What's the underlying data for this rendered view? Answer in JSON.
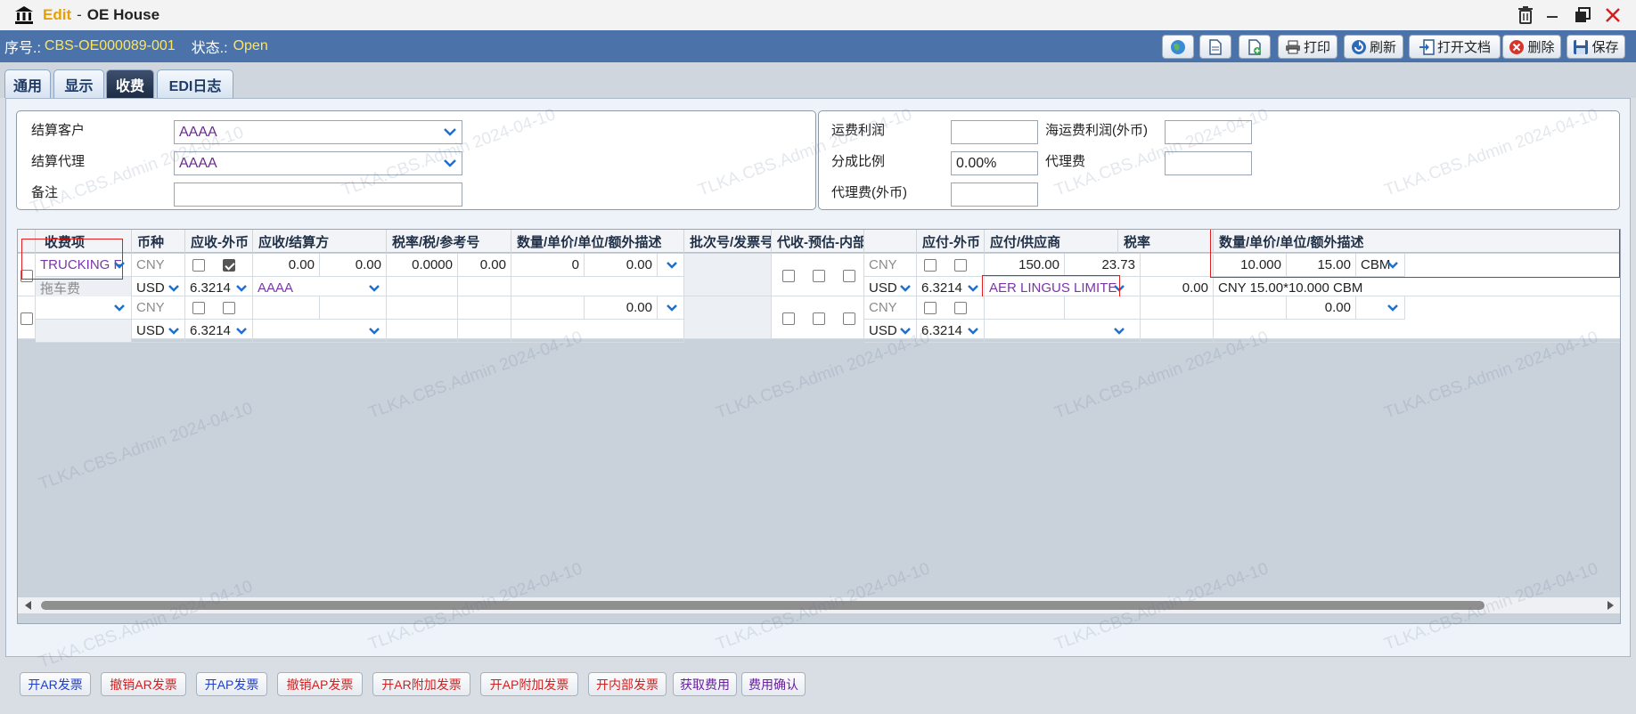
{
  "window": {
    "edit_label": "Edit",
    "separator": "-",
    "title": "OE House"
  },
  "header": {
    "serial_label": "序号.:",
    "serial_value": "CBS-OE000089-001",
    "status_label": "状态.:",
    "status_value": "Open"
  },
  "toolbar": {
    "print": "打印",
    "refresh": "刷新",
    "open_doc": "打开文档",
    "delete": "删除",
    "save": "保存"
  },
  "tabs": [
    "通用",
    "显示",
    "收费",
    "EDI日志"
  ],
  "form": {
    "settle_customer_label": "结算客户",
    "settle_customer_value": "AAAA",
    "settle_agent_label": "结算代理",
    "settle_agent_value": "AAAA",
    "remark_label": "备注",
    "remark_value": "",
    "freight_profit_label": "运费利润",
    "freight_profit_value": "",
    "ocean_profit_fc_label": "海运费利润(外币)",
    "ocean_profit_fc_value": "",
    "split_ratio_label": "分成比例",
    "split_ratio_value": "0.00%",
    "agent_fee_label": "代理费",
    "agent_fee_value": "",
    "agent_fee_fc_label": "代理费(外币)",
    "agent_fee_fc_value": ""
  },
  "grid": {
    "headers": [
      "收费项",
      "币种",
      "应收-外币",
      "应收/结算方",
      "税率/税/参考号",
      "数量/单价/单位/额外描述",
      "批次号/发票号",
      "代收-预估-内部",
      "",
      "应付-外币",
      "应付/供应商",
      "税率",
      "数量/单价/单位/额外描述"
    ],
    "rows": [
      {
        "item": "TRUCKING F",
        "item_sub": "拖车费",
        "ar_currency": "CNY",
        "ar_currency2": "USD",
        "ar_rate": "6.3214",
        "ar_amount1": "0.00",
        "ar_amount2": "0.00",
        "ar_party": "AAAA",
        "ar_tax_rate": "0.0000",
        "ar_tax": "0.00",
        "ar_qty": "0",
        "ar_price": "0.00",
        "ap_currency": "CNY",
        "ap_currency2": "USD",
        "ap_rate": "6.3214",
        "ap_amount1": "150.00",
        "ap_amount2": "23.73",
        "ap_vendor": "AER LINGUS LIMITE",
        "ap_tax": "0.00",
        "ap_qty": "10.000",
        "ap_price": "15.00",
        "ap_unit": "CBM",
        "ap_desc": "CNY 15.00*10.000 CBM"
      },
      {
        "ar_currency": "CNY",
        "ar_currency2": "USD",
        "ar_rate": "6.3214",
        "ar_price": "0.00",
        "ap_currency": "CNY",
        "ap_currency2": "USD",
        "ap_rate": "6.3214",
        "ap_price": "0.00"
      }
    ]
  },
  "footer_buttons": [
    "开AR发票",
    "撤销AR发票",
    "开AP发票",
    "撤销AP发票",
    "开AR附加发票",
    "开AP附加发票",
    "开内部发票",
    "获取费用",
    "费用确认"
  ],
  "colors": {
    "header_bar": "#4b73a9",
    "status_text": "#ffe45c",
    "edit_text": "#e8a000",
    "highlight": "#e02020"
  },
  "icons": [
    "bank-icon",
    "trash-icon",
    "minimize-icon",
    "restore-icon",
    "close-icon",
    "globe-icon",
    "document-icon",
    "add-document-icon",
    "printer-icon",
    "refresh-icon",
    "open-document-icon",
    "delete-icon",
    "save-icon",
    "chevron-down-icon"
  ]
}
